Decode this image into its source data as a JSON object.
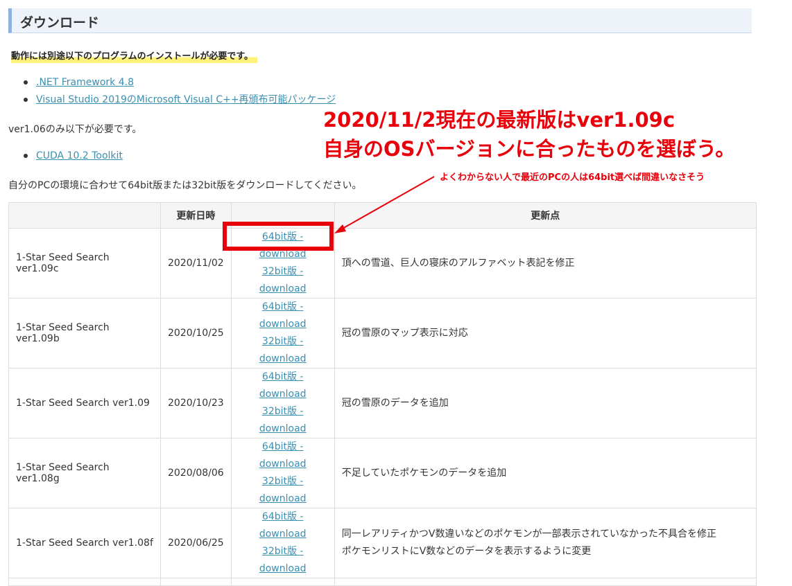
{
  "section": {
    "title": "ダウンロード"
  },
  "requirement_note": "動作には別途以下のプログラムのインストールが必要です。",
  "required_programs": [
    {
      "label": ".NET Framework 4.8"
    },
    {
      "label": "Visual Studio 2019のMicrosoft Visual C++再頒布可能パッケージ"
    }
  ],
  "cuda_note": "ver1.06のみ以下が必要です。",
  "cuda_link": "CUDA 10.2 Toolkit",
  "download_instruction": "自分のPCの環境に合わせて64bit版または32bit版をダウンロードしてください。",
  "table": {
    "headers": [
      "",
      "更新日時",
      "",
      "更新点"
    ],
    "link64": "64bit版 - download",
    "link32": "32bit版 - download",
    "rows": [
      {
        "name": "1-Star Seed Search ver1.09c",
        "date": "2020/11/02",
        "notes": [
          "頂への雪道、巨人の寝床のアルファベット表記を修正"
        ]
      },
      {
        "name": "1-Star Seed Search ver1.09b",
        "date": "2020/10/25",
        "notes": [
          "冠の雪原のマップ表示に対応"
        ]
      },
      {
        "name": "1-Star Seed Search ver1.09",
        "date": "2020/10/23",
        "notes": [
          "冠の雪原のデータを追加"
        ]
      },
      {
        "name": "1-Star Seed Search ver1.08g",
        "date": "2020/08/06",
        "notes": [
          "不足していたポケモンのデータを追加"
        ]
      },
      {
        "name": "1-Star Seed Search ver1.08f",
        "date": "2020/06/25",
        "notes": [
          "同一レアリティかつV数違いなどのポケモンが一部表示されていなかった不具合を修正",
          "ポケモンリストにV数などのデータを表示するように変更"
        ]
      }
    ]
  },
  "annotation": {
    "line1": "2020/11/2現在の最新版はver1.09c",
    "line2": "自身のOSバージョンに合ったものを選ぼう。",
    "small": "よくわからない人で最近のPCの人は64bit選べば間違いなさそう",
    "color": "#e8000a"
  },
  "colors": {
    "link": "#3a8fb0",
    "header_bg": "#eef3fa",
    "header_border": "#8fb3dc",
    "highlight": "#fff27a"
  }
}
